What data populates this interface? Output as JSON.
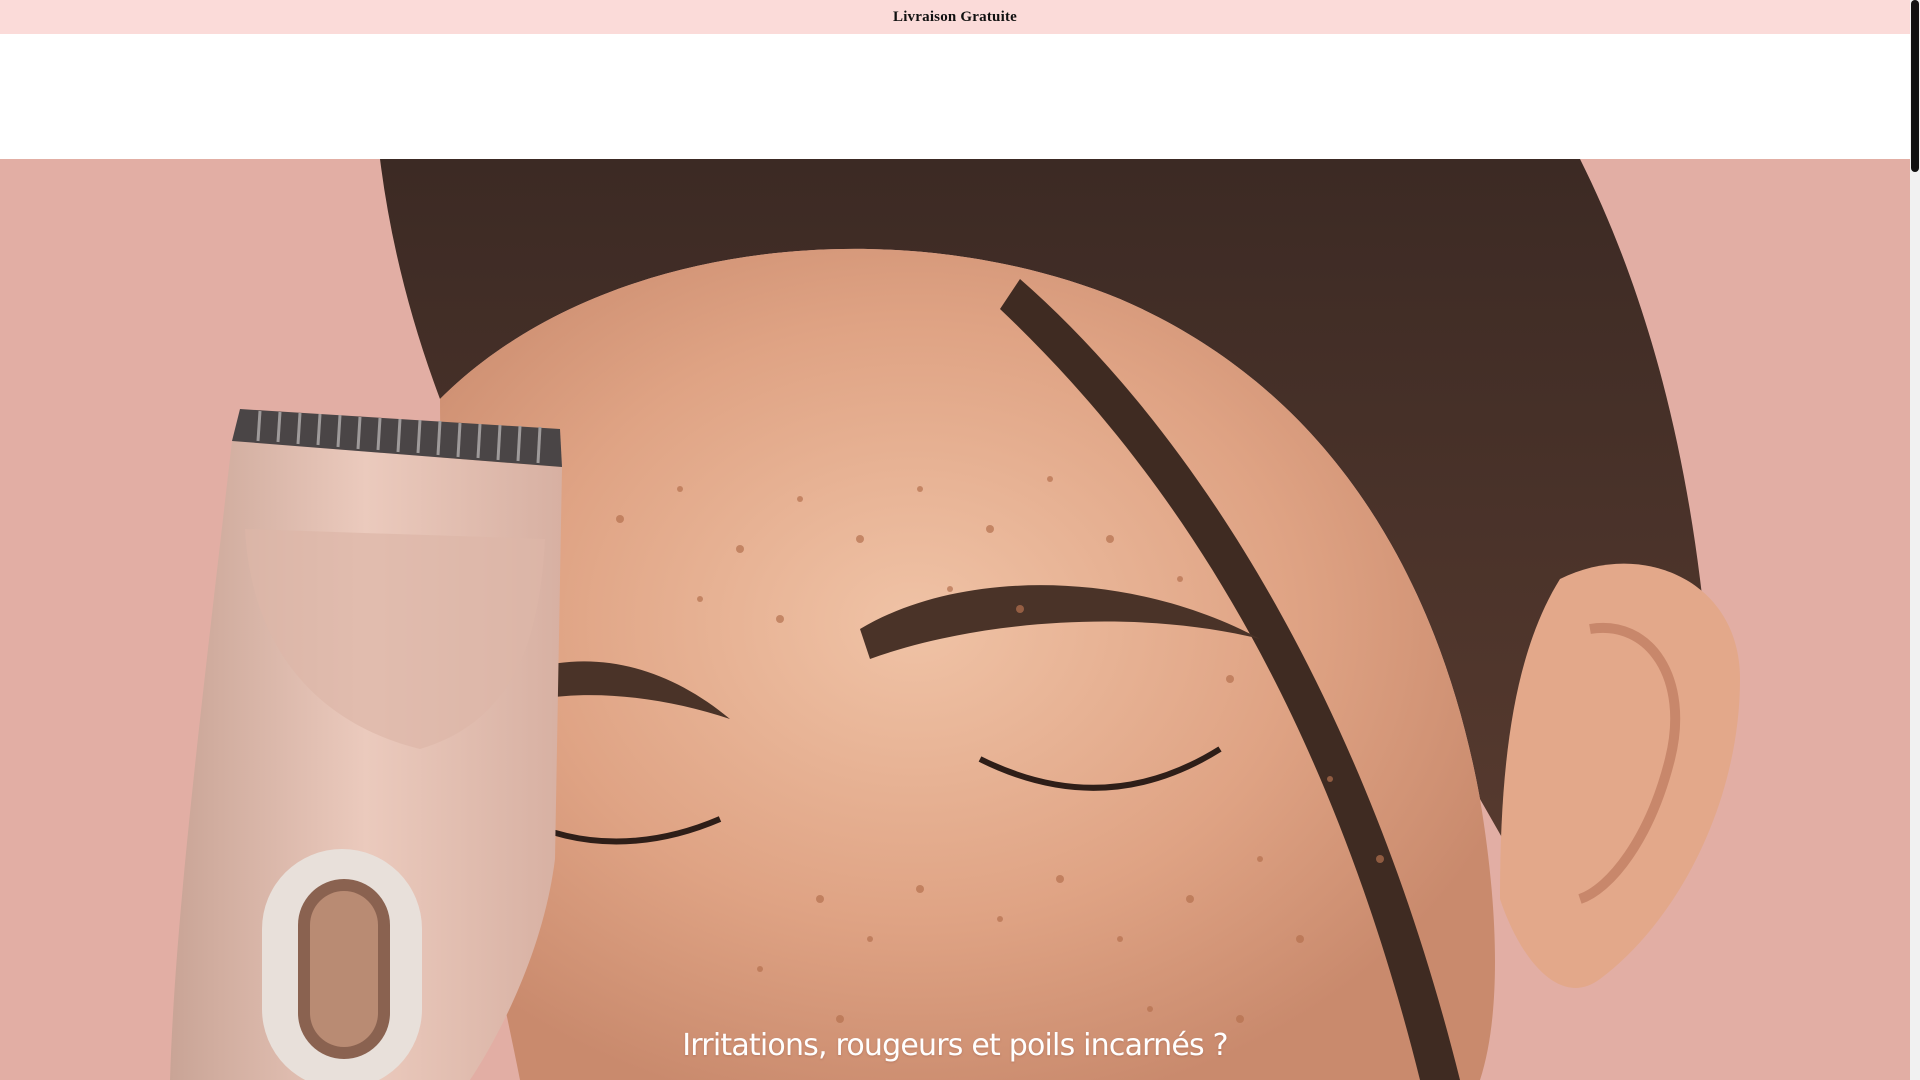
{
  "announcement": {
    "text": "Livraison Gratuite"
  },
  "hero": {
    "heading": "Irritations, rougeurs et poils incarnés ?",
    "image_subject": "smiling-woman-freckles-with-pink-trimmer",
    "background_color": "#e2aea4",
    "product_color": "#e7c4b8"
  },
  "scrollbar": {
    "thumb_color": "#111111"
  }
}
